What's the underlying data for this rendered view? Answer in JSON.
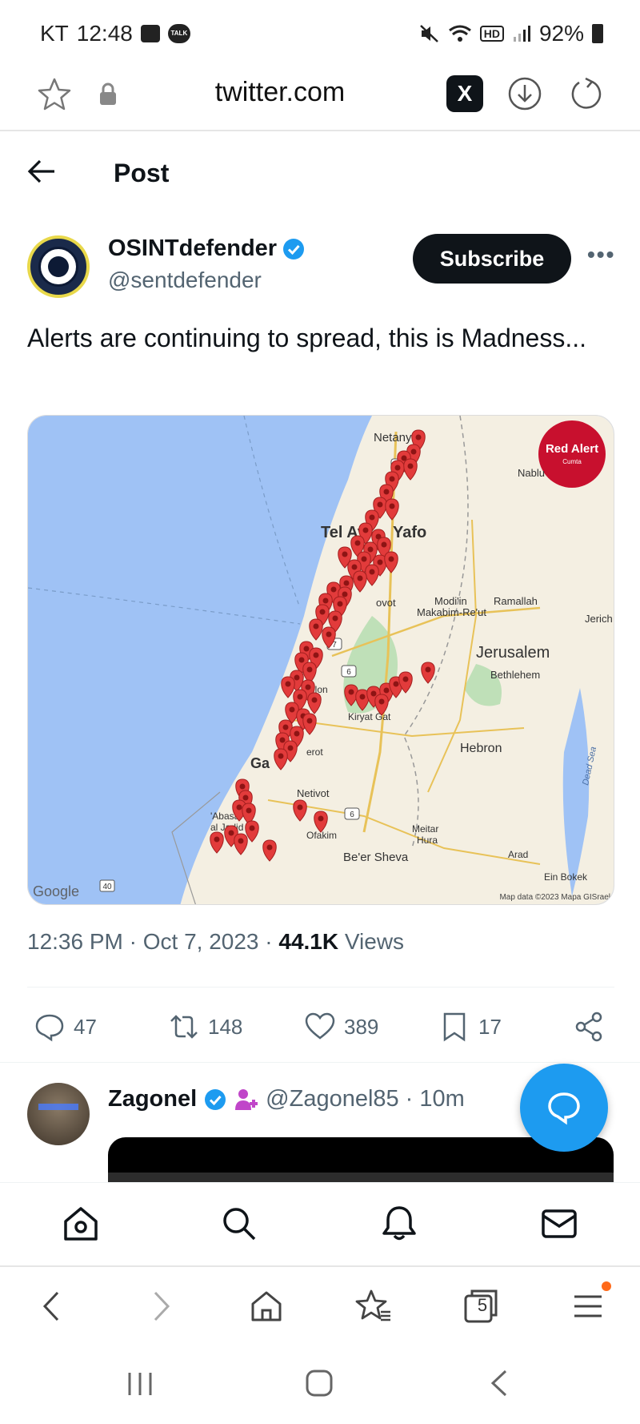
{
  "status_bar": {
    "carrier": "KT",
    "time": "12:48",
    "talk_label": "TALK",
    "hd_label": "HD",
    "battery": "92%"
  },
  "browser": {
    "host": "twitter.com",
    "x_label": "X",
    "tab_count": "5"
  },
  "header": {
    "title": "Post"
  },
  "post": {
    "author_name": "OSINTdefender",
    "author_handle": "@sentdefender",
    "subscribe_label": "Subscribe",
    "more_label": "•••",
    "text": "Alerts are continuing to spread, this is Madness...",
    "timestamp": "12:36 PM · Oct 7, 2023 · ",
    "views_count": "44.1K",
    "views_label": " Views",
    "replies": "47",
    "reposts": "148",
    "likes": "389",
    "bookmarks": "17"
  },
  "map": {
    "red_alert_title": "Red Alert",
    "red_alert_sub": "Cumta",
    "labels": {
      "netanya": "Netanya",
      "nablus": "Nablu",
      "tel_aviv": "Tel Av",
      "yafo": "Yafo",
      "rehovot": "ovot",
      "modiin": "Modi'in",
      "makabim": "Makabim-Re'ut",
      "ramallah": "Ramallah",
      "jericho": "Jerich",
      "jerusalem": "Jerusalem",
      "bethlehem": "Bethlehem",
      "ashkelon": "elon",
      "kiryat_gat": "Kiryat Gat",
      "hebron": "Hebron",
      "gaza": "Ga",
      "sderot": "erot",
      "netivot": "Netivot",
      "abasan": "'Abasa",
      "al_jadida": "al Jadid",
      "ofakim": "Ofakim",
      "meitar": "Meitar",
      "hura": "Hura",
      "beer_sheva": "Be'er Sheva",
      "arad": "Arad",
      "ein_bokek": "Ein Bokek",
      "dead_sea": "Dead Sea",
      "route_6a": "6",
      "route_7": "7",
      "route_6b": "6",
      "route_6c": "6",
      "route_40": "40",
      "google": "Google",
      "attribution": "Map data ©2023 Mapa GISrael"
    }
  },
  "next_post": {
    "author_name": "Zagonel",
    "author_handle": "@Zagonel85",
    "time": " · 10m"
  },
  "colors": {
    "accent": "#1d9bf0",
    "sea": "#9fc2f5",
    "land": "#f4efe2",
    "pin": "#e23b3b",
    "red_alert": "#c8102e"
  },
  "icons": {
    "back": "arrow-left-icon",
    "favorite": "star-icon",
    "lock": "lock-icon",
    "download": "download-icon",
    "reload": "reload-icon",
    "reply": "reply-icon",
    "repost": "repost-icon",
    "like": "heart-icon",
    "bookmark": "bookmark-icon",
    "share": "share-icon",
    "compose": "compose-icon",
    "home": "home-icon",
    "search": "search-icon",
    "notifications": "bell-icon",
    "messages": "mail-icon"
  }
}
